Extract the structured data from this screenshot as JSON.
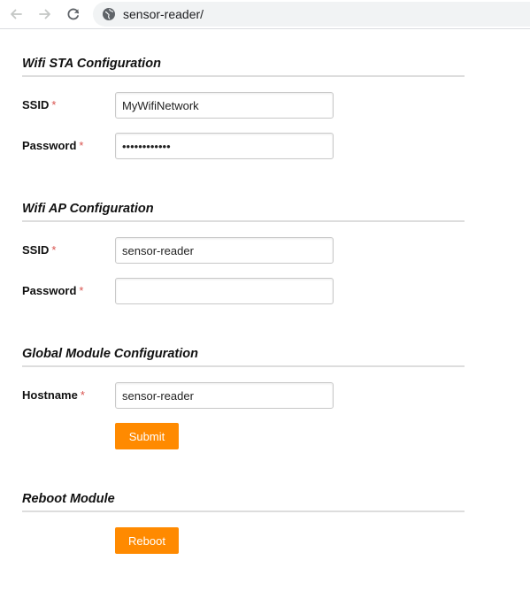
{
  "browser": {
    "url": "sensor-reader/"
  },
  "sta": {
    "title": "Wifi STA Configuration",
    "ssid_label": "SSID",
    "ssid_value": "MyWifiNetwork",
    "password_label": "Password",
    "password_value": "passwordpass"
  },
  "ap": {
    "title": "Wifi AP Configuration",
    "ssid_label": "SSID",
    "ssid_value": "sensor-reader",
    "password_label": "Password",
    "password_value": ""
  },
  "global": {
    "title": "Global Module Configuration",
    "hostname_label": "Hostname",
    "hostname_value": "sensor-reader",
    "submit_label": "Submit"
  },
  "reboot": {
    "title": "Reboot Module",
    "reboot_label": "Reboot"
  },
  "required_mark": "*",
  "colors": {
    "accent": "#ff8a00",
    "required": "#d9534f",
    "divider": "#dddddd"
  }
}
